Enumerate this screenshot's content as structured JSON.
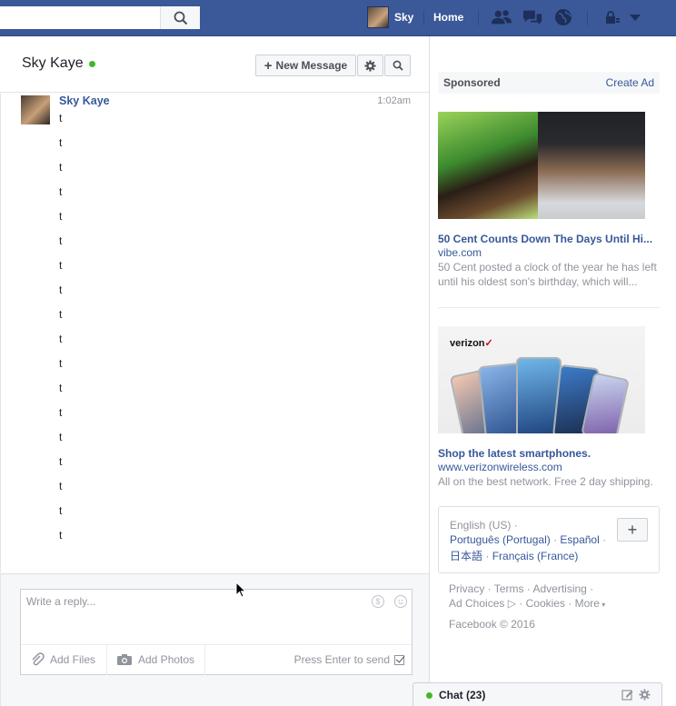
{
  "topbar": {
    "search_placeholder": "",
    "user_name": "Sky",
    "home_label": "Home"
  },
  "conversation": {
    "name": "Sky Kaye",
    "new_message_label": "New Message",
    "message": {
      "sender": "Sky Kaye",
      "time": "1:02am",
      "lines": [
        "t",
        "t",
        "t",
        "t",
        "t",
        "t",
        "t",
        "t",
        "t",
        "t",
        "t",
        "t",
        "t",
        "t",
        "t",
        "t",
        "t",
        "t"
      ]
    }
  },
  "reply": {
    "placeholder": "Write a reply...",
    "add_files_label": "Add Files",
    "add_photos_label": "Add Photos",
    "press_enter_label": "Press Enter to send"
  },
  "sidebar": {
    "sponsored_label": "Sponsored",
    "create_ad_label": "Create Ad",
    "ads": [
      {
        "title": "50 Cent Counts Down The Days Until Hi...",
        "domain": "vibe.com",
        "description": "50 Cent posted a clock of the year he has left until his oldest son's birthday, which will..."
      },
      {
        "title": "Shop the latest smartphones.",
        "domain": "www.verizonwireless.com",
        "description": "All on the best network. Free 2 day shipping.",
        "brand_logo": "verizon"
      }
    ],
    "languages": {
      "current": "English (US)",
      "portugues": "Português (Portugal)",
      "espanol": "Español",
      "japanese": "日本語",
      "francais": "Français (France)",
      "add_label": "+"
    },
    "footer": {
      "privacy": "Privacy",
      "terms": "Terms",
      "advertising": "Advertising",
      "ad_choices": "Ad Choices",
      "cookies": "Cookies",
      "more": "More",
      "copyright": "Facebook © 2016"
    }
  },
  "chat": {
    "label": "Chat (23)"
  },
  "colors": {
    "brand_blue": "#3b5998",
    "link_blue": "#365899",
    "online_green": "#42b72a"
  }
}
